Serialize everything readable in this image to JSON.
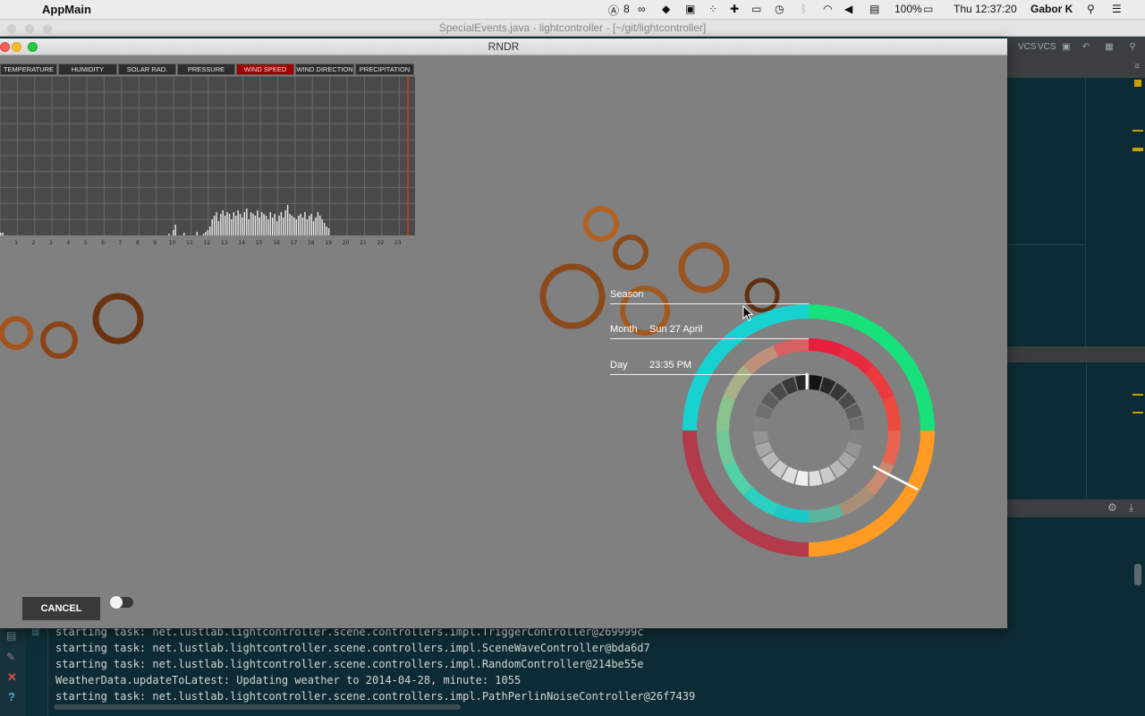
{
  "menubar": {
    "app_name": "AppMain",
    "status_items": [
      "8",
      "100%",
      "Thu 12:37:20",
      "Gabor K"
    ]
  },
  "ide": {
    "window_title": "SpecialEvents.java - lightcontroller - [~/git/lightcontroller]",
    "toolbar_labels": [
      "VCS",
      "VCS"
    ],
    "console_lines": [
      "starting task: net.lustlab.lightcontroller.scene.controllers.impl.TriggerController@269999c",
      "starting task: net.lustlab.lightcontroller.scene.controllers.impl.SceneWaveController@bda6d7",
      "starting task: net.lustlab.lightcontroller.scene.controllers.impl.RandomController@214be55e",
      "WeatherData.updateToLatest: Updating weather to 2014-04-28, minute: 1055",
      "starting task: net.lustlab.lightcontroller.scene.controllers.impl.PathPerlinNoiseController@26f7439"
    ]
  },
  "rndr": {
    "title": "RNDR",
    "weather_tabs": [
      "TEMPERATURE",
      "HUMIDITY",
      "SOLAR RAD.",
      "PRESSURE",
      "WIND SPEED",
      "WIND DIRECTION",
      "PRECIPITATION"
    ],
    "active_tab": "WIND SPEED",
    "hour_ticks": [
      "1",
      "2",
      "3",
      "4",
      "5",
      "6",
      "7",
      "8",
      "9",
      "10",
      "11",
      "12",
      "13",
      "14",
      "15",
      "16",
      "17",
      "18",
      "19",
      "20",
      "21",
      "22",
      "23"
    ],
    "wind_bars": [
      3,
      3,
      0,
      0,
      0,
      0,
      0,
      0,
      0,
      0,
      0,
      0,
      0,
      0,
      0,
      0,
      0,
      0,
      0,
      0,
      0,
      0,
      0,
      0,
      0,
      0,
      0,
      0,
      0,
      0,
      0,
      0,
      0,
      0,
      0,
      0,
      0,
      0,
      0,
      0,
      0,
      0,
      0,
      0,
      0,
      0,
      0,
      0,
      0,
      0,
      0,
      0,
      0,
      0,
      0,
      0,
      0,
      0,
      0,
      0,
      0,
      0,
      0,
      0,
      0,
      0,
      0,
      0,
      0,
      0,
      0,
      0,
      0,
      0,
      0,
      0,
      0,
      0,
      2,
      0,
      6,
      12,
      0,
      0,
      0,
      3,
      0,
      0,
      0,
      0,
      0,
      4,
      0,
      0,
      2,
      4,
      6,
      10,
      18,
      22,
      26,
      16,
      24,
      28,
      22,
      26,
      24,
      18,
      26,
      22,
      28,
      24,
      20,
      26,
      30,
      18,
      26,
      24,
      22,
      28,
      20,
      26,
      24,
      22,
      18,
      26,
      20,
      24,
      16,
      22,
      26,
      20,
      28,
      34,
      24,
      22,
      20,
      18,
      22,
      24,
      20,
      26,
      18,
      22,
      24,
      16,
      20,
      26,
      22,
      18,
      14,
      10,
      8,
      0,
      0,
      0,
      0,
      0,
      0,
      0,
      0,
      0,
      0,
      0,
      0,
      0,
      0,
      0,
      0,
      0,
      0,
      0,
      0,
      0,
      0,
      0,
      0,
      0,
      0,
      0,
      0,
      0,
      0,
      0,
      0,
      0,
      0,
      0,
      0
    ],
    "dial": {
      "season_label": "Season",
      "month_label": "Month",
      "month_value": "Sun 27 April",
      "day_label": "Day",
      "day_value": "23:35 PM"
    },
    "cancel_label": "CANCEL",
    "toggle_on": false
  },
  "colors": {
    "spring": "#18e07a",
    "summer": "#ff9a22",
    "autumn": "#b23a4a",
    "winter": "#18d2d2",
    "ring": "#8a4a1c"
  }
}
